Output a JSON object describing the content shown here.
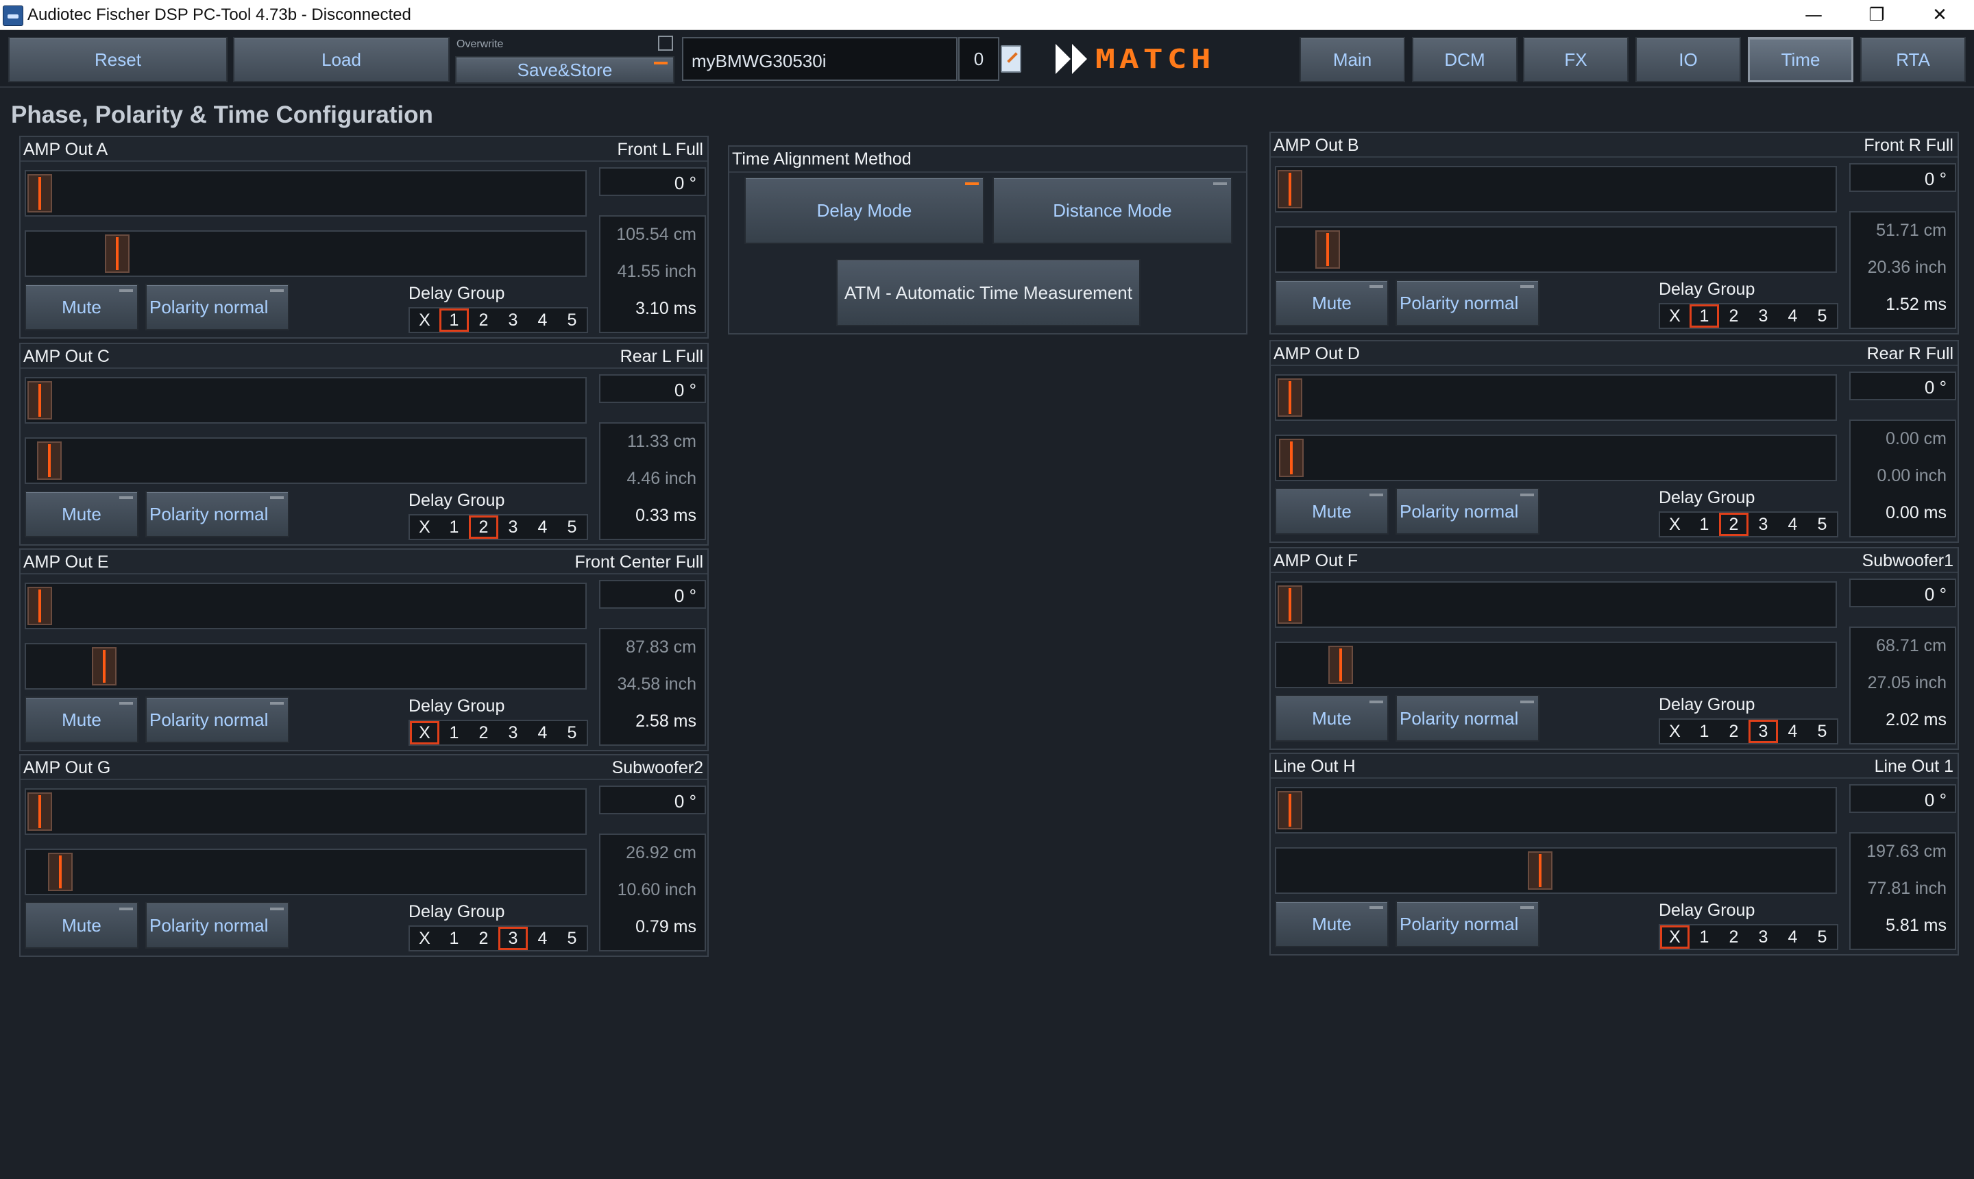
{
  "window": {
    "title": "Audiotec Fischer DSP PC-Tool 4.73b - Disconnected",
    "minimize": "—",
    "maximize": "❐",
    "close": "✕"
  },
  "toolbar": {
    "reset": "Reset",
    "load": "Load",
    "overwrite_label": "Overwrite",
    "save_store": "Save&Store",
    "preset_name": "myBMWG30530i",
    "preset_number": "0",
    "logo_text": "MATCH",
    "tabs": [
      "Main",
      "DCM",
      "FX",
      "IO",
      "Time",
      "RTA"
    ],
    "active_tab": "Time"
  },
  "page_title": "Phase, Polarity & Time Configuration",
  "time_alignment": {
    "title": "Time Alignment Method",
    "delay_mode": "Delay Mode",
    "distance_mode": "Distance Mode",
    "atm": "ATM - Automatic Time Measurement",
    "active_mode": "Delay Mode"
  },
  "labels": {
    "mute": "Mute",
    "polarity": "Polarity normal",
    "delay_group": "Delay Group",
    "dg_options": [
      "X",
      "1",
      "2",
      "3",
      "4",
      "5"
    ]
  },
  "channels": [
    {
      "id": "a",
      "name": "AMP Out A",
      "assign": "Front L Full",
      "phase": "0 °",
      "cm": "105.54 cm",
      "inch": "41.55 inch",
      "ms": "3.10 ms",
      "group": "1",
      "delay_frac": 0.142
    },
    {
      "id": "c",
      "name": "AMP Out C",
      "assign": "Rear L Full",
      "phase": "0 °",
      "cm": "11.33 cm",
      "inch": "4.46 inch",
      "ms": "0.33 ms",
      "group": "2",
      "delay_frac": 0.015
    },
    {
      "id": "e",
      "name": "AMP Out E",
      "assign": "Front Center Full",
      "phase": "0 °",
      "cm": "87.83 cm",
      "inch": "34.58 inch",
      "ms": "2.58 ms",
      "group": "X",
      "delay_frac": 0.118
    },
    {
      "id": "g",
      "name": "AMP Out G",
      "assign": "Subwoofer2",
      "phase": "0 °",
      "cm": "26.92 cm",
      "inch": "10.60 inch",
      "ms": "0.79 ms",
      "group": "3",
      "delay_frac": 0.036
    },
    {
      "id": "b",
      "name": "AMP Out B",
      "assign": "Front R Full",
      "phase": "0 °",
      "cm": "51.71 cm",
      "inch": "20.36 inch",
      "ms": "1.52 ms",
      "group": "1",
      "delay_frac": 0.068
    },
    {
      "id": "d",
      "name": "AMP Out D",
      "assign": "Rear R Full",
      "phase": "0 °",
      "cm": "0.00 cm",
      "inch": "0.00 inch",
      "ms": "0.00 ms",
      "group": "2",
      "delay_frac": 0.0
    },
    {
      "id": "f",
      "name": "AMP Out F",
      "assign": "Subwoofer1",
      "phase": "0 °",
      "cm": "68.71 cm",
      "inch": "27.05 inch",
      "ms": "2.02 ms",
      "group": "3",
      "delay_frac": 0.092
    },
    {
      "id": "h",
      "name": "Line Out H",
      "assign": "Line Out 1",
      "phase": "0 °",
      "cm": "197.63 cm",
      "inch": "77.81 inch",
      "ms": "5.81 ms",
      "group": "X",
      "delay_frac": 0.466
    }
  ]
}
